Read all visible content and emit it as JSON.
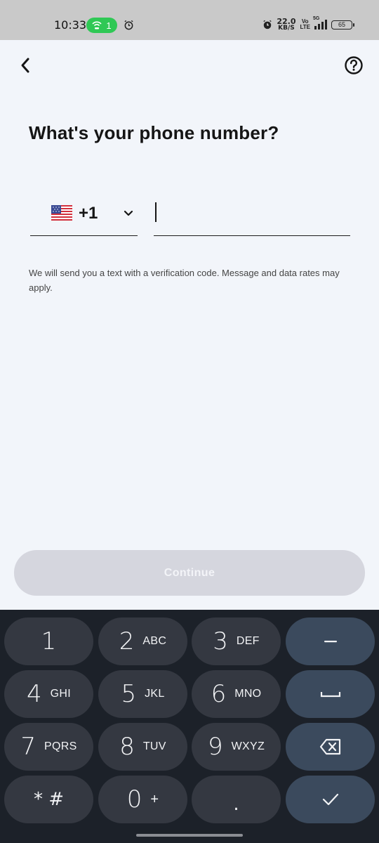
{
  "status_bar": {
    "time": "10:33",
    "hotspot_count": "1",
    "net_speed_value": "22.0",
    "net_speed_unit": "KB/S",
    "volte_top": "Vo",
    "volte_bottom": "LTE",
    "network_type": "5G",
    "battery": "65"
  },
  "header": {
    "back_icon": "chevron-left-icon",
    "help_icon": "question-circle-icon"
  },
  "page": {
    "title": "What's your phone number?",
    "country_flag": "us-flag-icon",
    "dial_code": "+1",
    "phone_value": "",
    "helper_text": "We will send you a text with a verification code. Message and data rates may apply.",
    "continue_label": "Continue"
  },
  "keyboard": {
    "keys": [
      {
        "digit": "1",
        "letters": ""
      },
      {
        "digit": "2",
        "letters": "ABC"
      },
      {
        "digit": "3",
        "letters": "DEF"
      },
      {
        "digit": "4",
        "letters": "GHI"
      },
      {
        "digit": "5",
        "letters": "JKL"
      },
      {
        "digit": "6",
        "letters": "MNO"
      },
      {
        "digit": "7",
        "letters": "PQRS"
      },
      {
        "digit": "8",
        "letters": "TUV"
      },
      {
        "digit": "9",
        "letters": "WXYZ"
      },
      {
        "digit": "* #",
        "letters": ""
      },
      {
        "digit": "0",
        "letters": "+"
      },
      {
        "digit": ".",
        "letters": ""
      }
    ],
    "action_keys": [
      "minus-icon",
      "space-icon",
      "backspace-icon",
      "checkmark-icon"
    ]
  },
  "colors": {
    "background": "#f2f5fa",
    "status_bar": "#c9c9c9",
    "hotspot_green": "#2fc855",
    "continue_disabled": "#d5d6de",
    "keyboard_bg": "#1c2129",
    "key_bg": "#343841",
    "action_key_bg": "#3b4a5d"
  }
}
